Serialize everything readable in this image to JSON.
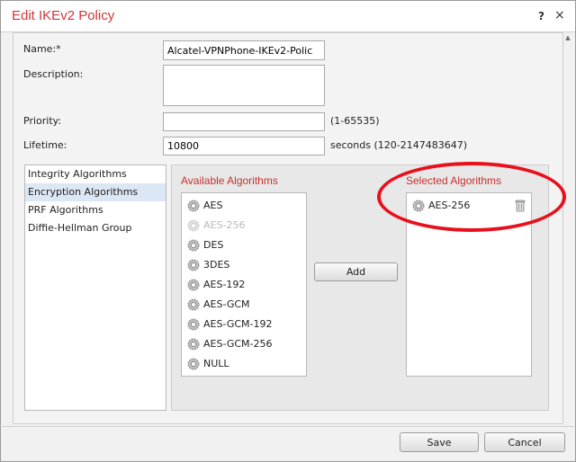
{
  "dialog": {
    "title": "Edit IKEv2 Policy",
    "help_glyph": "?",
    "close_glyph": "×"
  },
  "form": {
    "name_label": "Name:*",
    "name_value": "Alcatel-VPNPhone-IKEv2-Polic",
    "description_label": "Description:",
    "description_value": "",
    "priority_label": "Priority:",
    "priority_value": "",
    "priority_hint": "(1-65535)",
    "lifetime_label": "Lifetime:",
    "lifetime_value": "10800",
    "lifetime_hint": "seconds (120-2147483647)"
  },
  "categories": [
    {
      "label": "Integrity Algorithms",
      "selected": false
    },
    {
      "label": "Encryption Algorithms",
      "selected": true
    },
    {
      "label": "PRF Algorithms",
      "selected": false
    },
    {
      "label": "Diffie-Hellman Group",
      "selected": false
    }
  ],
  "available": {
    "title": "Available Algorithms",
    "items": [
      {
        "label": "AES",
        "disabled": false
      },
      {
        "label": "AES-256",
        "disabled": true
      },
      {
        "label": "DES",
        "disabled": false
      },
      {
        "label": "3DES",
        "disabled": false
      },
      {
        "label": "AES-192",
        "disabled": false
      },
      {
        "label": "AES-GCM",
        "disabled": false
      },
      {
        "label": "AES-GCM-192",
        "disabled": false
      },
      {
        "label": "AES-GCM-256",
        "disabled": false
      },
      {
        "label": "NULL",
        "disabled": false
      }
    ]
  },
  "selected": {
    "title": "Selected Algorithms",
    "items": [
      {
        "label": "AES-256"
      }
    ]
  },
  "buttons": {
    "add": "Add",
    "save": "Save",
    "cancel": "Cancel"
  },
  "colors": {
    "accent": "#d0363a",
    "annotation": "#e8101c"
  }
}
